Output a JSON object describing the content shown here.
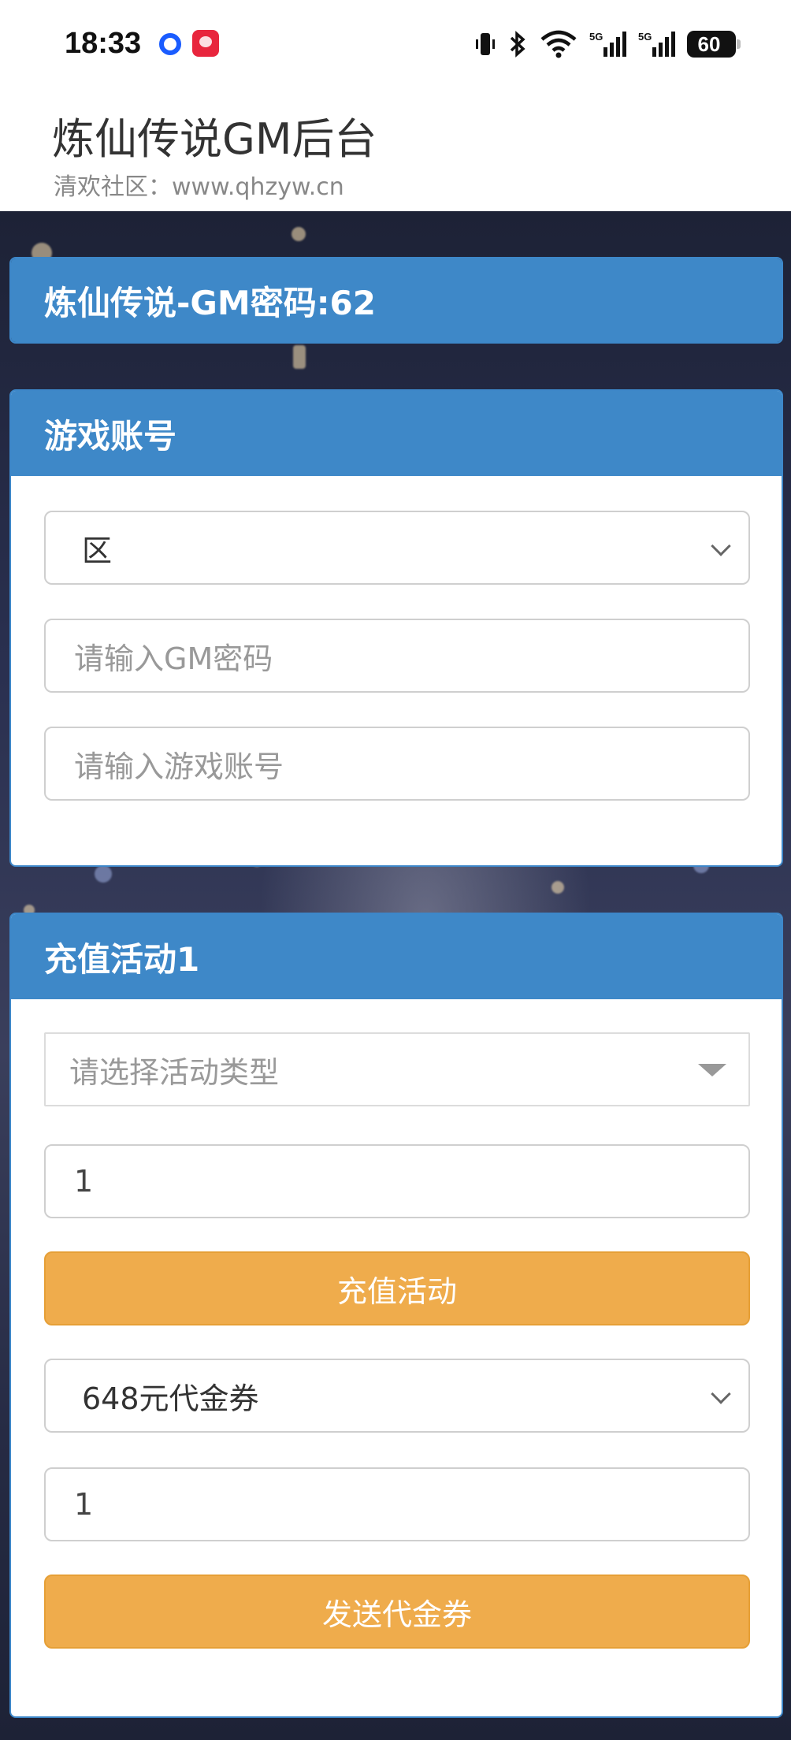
{
  "status_bar": {
    "time": "18:33",
    "battery": "60",
    "icons": [
      "vibrate-icon",
      "bluetooth-icon",
      "wifi-icon",
      "signal-5g-icon",
      "signal-5g-icon",
      "battery-icon"
    ]
  },
  "header": {
    "title": "炼仙传说GM后台",
    "subtitle": "清欢社区：www.qhzyw.cn"
  },
  "title_card": {
    "heading": "炼仙传说-GM密码:62"
  },
  "account_card": {
    "heading": "游戏账号",
    "server_select": "区",
    "gm_password_placeholder": "请输入GM密码",
    "account_placeholder": "请输入游戏账号"
  },
  "recharge_card": {
    "heading": "充值活动1",
    "activity_type_placeholder": "请选择活动类型",
    "activity_quantity": "1",
    "recharge_button": "充值活动",
    "voucher_select": "648元代金券",
    "voucher_quantity": "1",
    "send_voucher_button": "发送代金券"
  },
  "colors": {
    "header_blue": "#3e88c8",
    "button_orange": "#efac4c"
  }
}
